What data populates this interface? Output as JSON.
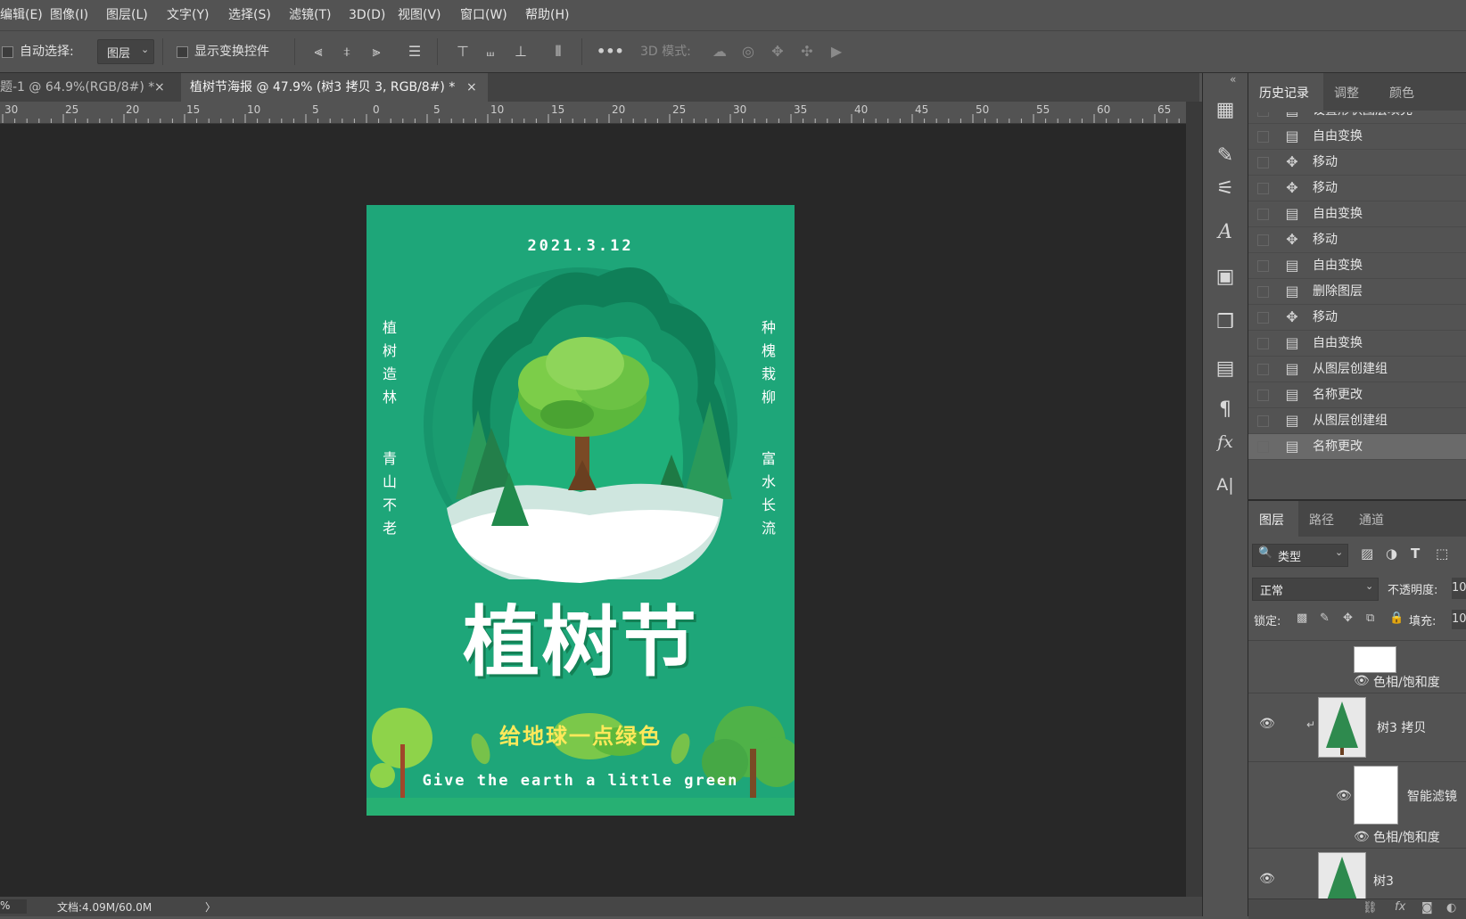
{
  "menubar": {
    "items": [
      "编辑(E)",
      "图像(I)",
      "图层(L)",
      "文字(Y)",
      "选择(S)",
      "滤镜(T)",
      "3D(D)",
      "视图(V)",
      "窗口(W)",
      "帮助(H)"
    ]
  },
  "options": {
    "auto_select_label": "自动选择:",
    "auto_select_value": "图层",
    "show_transform_label": "显示变换控件",
    "mode3d_label": "3D 模式:"
  },
  "tabs": [
    {
      "label": "题-1 @ 64.9%(RGB/8#) *",
      "close": "×"
    },
    {
      "label": "植树节海报 @ 47.9% (树3 拷贝 3, RGB/8#) *",
      "close": "×"
    }
  ],
  "ruler": {
    "labels": [
      "30",
      "25",
      "20",
      "15",
      "10",
      "5",
      "0",
      "5",
      "10",
      "15",
      "20",
      "25",
      "30",
      "35",
      "40",
      "45",
      "50",
      "55",
      "60",
      "65"
    ]
  },
  "poster": {
    "date": "2021.3.12",
    "left_text_1": "植树造林",
    "left_text_2": "青山不老",
    "right_text_1": "种槐栽柳",
    "right_text_2": "富水长流",
    "title": "植树节",
    "slogan_cn": "给地球一点绿色",
    "slogan_en": "Give the earth a little green",
    "colors": {
      "background": "#1ea679",
      "title": "#ffffff",
      "slogan": "#ffe95a"
    }
  },
  "history": {
    "tabs": [
      "历史记录",
      "调整",
      "颜色"
    ],
    "items": [
      {
        "icon": "doc-icon",
        "label": "设置形状图层填充"
      },
      {
        "icon": "doc-icon",
        "label": "自由变换"
      },
      {
        "icon": "move-icon",
        "label": "移动"
      },
      {
        "icon": "move-icon",
        "label": "移动"
      },
      {
        "icon": "doc-icon",
        "label": "自由变换"
      },
      {
        "icon": "move-icon",
        "label": "移动"
      },
      {
        "icon": "doc-icon",
        "label": "自由变换"
      },
      {
        "icon": "doc-icon",
        "label": "删除图层"
      },
      {
        "icon": "move-icon",
        "label": "移动"
      },
      {
        "icon": "doc-icon",
        "label": "自由变换"
      },
      {
        "icon": "doc-icon",
        "label": "从图层创建组"
      },
      {
        "icon": "doc-icon",
        "label": "名称更改"
      },
      {
        "icon": "doc-icon",
        "label": "从图层创建组"
      },
      {
        "icon": "doc-icon",
        "label": "名称更改"
      }
    ]
  },
  "layers": {
    "tabs": [
      "图层",
      "路径",
      "通道"
    ],
    "filter_label": "类型",
    "blend_mode": "正常",
    "opacity_label": "不透明度:",
    "opacity_value": "10",
    "lock_label": "锁定:",
    "fill_label": "填充:",
    "fill_value": "10",
    "rows": {
      "hue1": "色相/饱和度",
      "tree3copy": "树3 拷贝",
      "smart_filter": "智能滤镜",
      "hue2": "色相/饱和度",
      "tree3": "树3"
    }
  },
  "status": {
    "zoom": "%",
    "doc": "文档:4.09M/60.0M",
    "arrow": "〉"
  }
}
